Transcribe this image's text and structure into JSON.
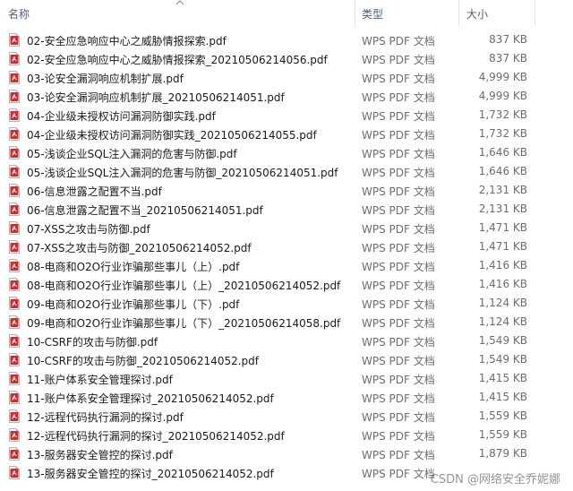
{
  "header": {
    "name_label": "名称",
    "type_label": "类型",
    "size_label": "大小"
  },
  "files": [
    {
      "name": "02-安全应急响应中心之威胁情报探索.pdf",
      "type": "WPS PDF 文档",
      "size": "837 KB"
    },
    {
      "name": "02-安全应急响应中心之威胁情报探索_20210506214056.pdf",
      "type": "WPS PDF 文档",
      "size": "837 KB"
    },
    {
      "name": "03-论安全漏洞响应机制扩展.pdf",
      "type": "WPS PDF 文档",
      "size": "4,999 KB"
    },
    {
      "name": "03-论安全漏洞响应机制扩展_20210506214051.pdf",
      "type": "WPS PDF 文档",
      "size": "4,999 KB"
    },
    {
      "name": "04-企业级未授权访问漏洞防御实践.pdf",
      "type": "WPS PDF 文档",
      "size": "1,732 KB"
    },
    {
      "name": "04-企业级未授权访问漏洞防御实践_20210506214055.pdf",
      "type": "WPS PDF 文档",
      "size": "1,732 KB"
    },
    {
      "name": "05-浅谈企业SQL注入漏洞的危害与防御.pdf",
      "type": "WPS PDF 文档",
      "size": "1,646 KB"
    },
    {
      "name": "05-浅谈企业SQL注入漏洞的危害与防御_20210506214051.pdf",
      "type": "WPS PDF 文档",
      "size": "1,646 KB"
    },
    {
      "name": "06-信息泄露之配置不当.pdf",
      "type": "WPS PDF 文档",
      "size": "2,131 KB"
    },
    {
      "name": "06-信息泄露之配置不当_20210506214051.pdf",
      "type": "WPS PDF 文档",
      "size": "2,131 KB"
    },
    {
      "name": "07-XSS之攻击与防御.pdf",
      "type": "WPS PDF 文档",
      "size": "1,471 KB"
    },
    {
      "name": "07-XSS之攻击与防御_20210506214052.pdf",
      "type": "WPS PDF 文档",
      "size": "1,471 KB"
    },
    {
      "name": "08-电商和O2O行业诈骗那些事儿（上）.pdf",
      "type": "WPS PDF 文档",
      "size": "1,416 KB"
    },
    {
      "name": "08-电商和O2O行业诈骗那些事儿（上）_20210506214052.pdf",
      "type": "WPS PDF 文档",
      "size": "1,416 KB"
    },
    {
      "name": "09-电商和O2O行业诈骗那些事儿（下）.pdf",
      "type": "WPS PDF 文档",
      "size": "1,124 KB"
    },
    {
      "name": "09-电商和O2O行业诈骗那些事儿（下）_20210506214058.pdf",
      "type": "WPS PDF 文档",
      "size": "1,124 KB"
    },
    {
      "name": "10-CSRF的攻击与防御.pdf",
      "type": "WPS PDF 文档",
      "size": "1,549 KB"
    },
    {
      "name": "10-CSRF的攻击与防御_20210506214052.pdf",
      "type": "WPS PDF 文档",
      "size": "1,549 KB"
    },
    {
      "name": "11-账户体系安全管理探讨.pdf",
      "type": "WPS PDF 文档",
      "size": "1,415 KB"
    },
    {
      "name": "11-账户体系安全管理探讨_20210506214052.pdf",
      "type": "WPS PDF 文档",
      "size": "1,415 KB"
    },
    {
      "name": "12-远程代码执行漏洞的探讨.pdf",
      "type": "WPS PDF 文档",
      "size": "1,559 KB"
    },
    {
      "name": "12-远程代码执行漏洞的探讨_20210506214052.pdf",
      "type": "WPS PDF 文档",
      "size": "1,559 KB"
    },
    {
      "name": "13-服务器安全管控的探讨.pdf",
      "type": "WPS PDF 文档",
      "size": "1,879 KB"
    },
    {
      "name": "13-服务器安全管控的探讨_20210506214052.pdf",
      "type": "WPS PDF 文档",
      "size": ""
    }
  ],
  "watermark": "CSDN @网络安全乔妮娜",
  "icon": "pdf-file-icon",
  "colors": {
    "pdf_icon_red": "#d8262e",
    "header_text": "#4c607a",
    "meta_text": "#6d6d6d"
  }
}
